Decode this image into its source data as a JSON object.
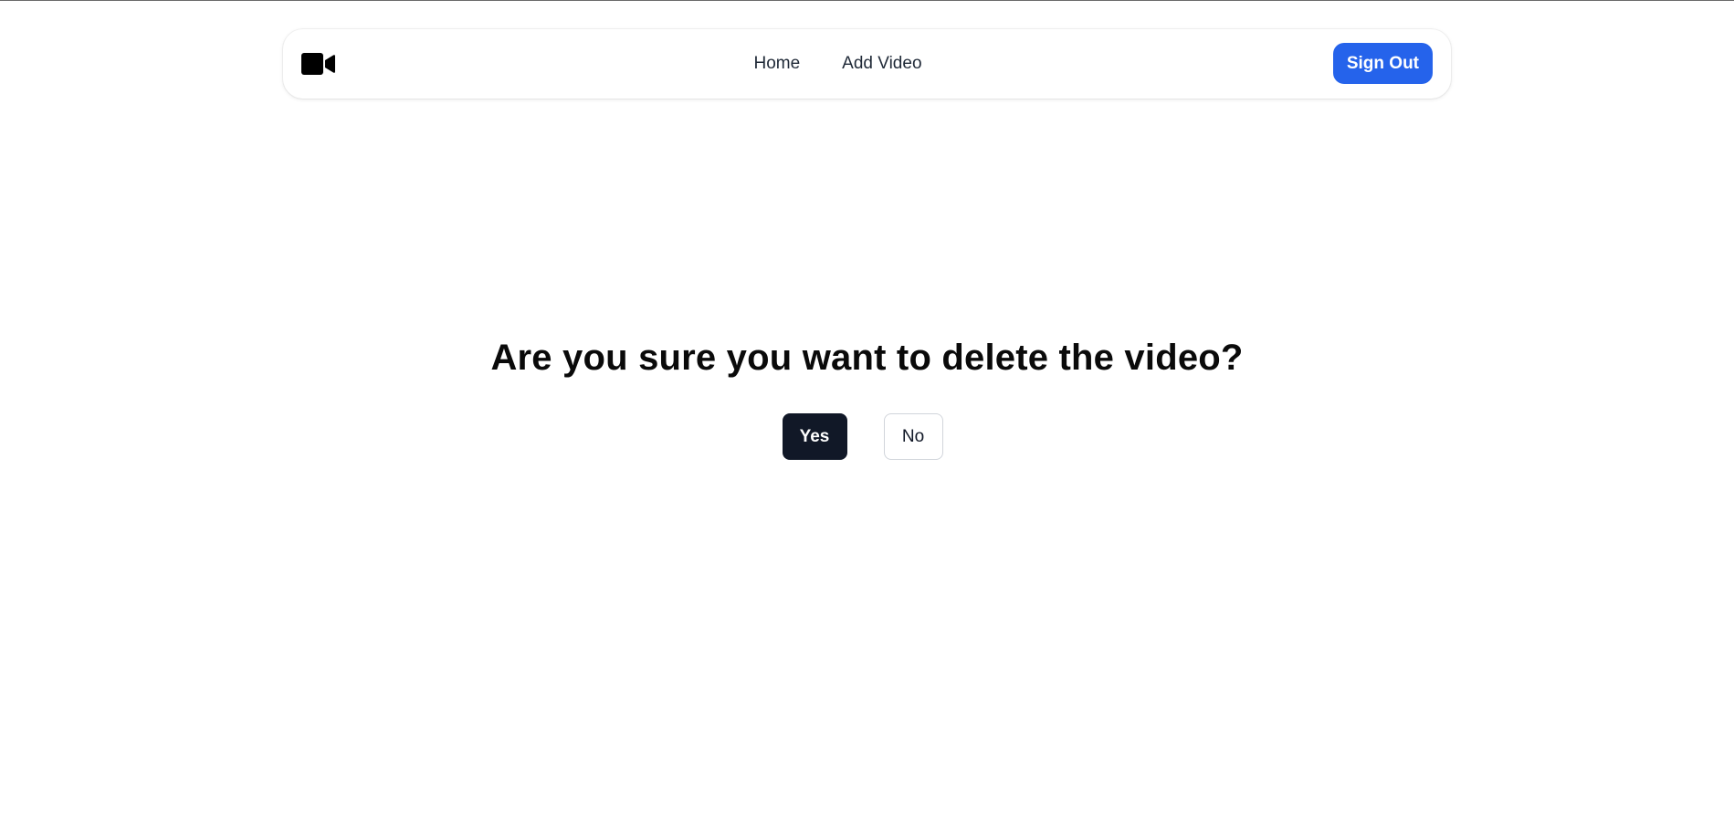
{
  "nav": {
    "logo_icon": "video-camera-icon",
    "links": [
      {
        "label": "Home"
      },
      {
        "label": "Add Video"
      }
    ],
    "sign_out_label": "Sign Out",
    "sign_out_color": "#2563eb"
  },
  "dialog": {
    "question": "Are you sure you want to delete the video?",
    "yes_label": "Yes",
    "no_label": "No",
    "yes_color": "#111827"
  }
}
